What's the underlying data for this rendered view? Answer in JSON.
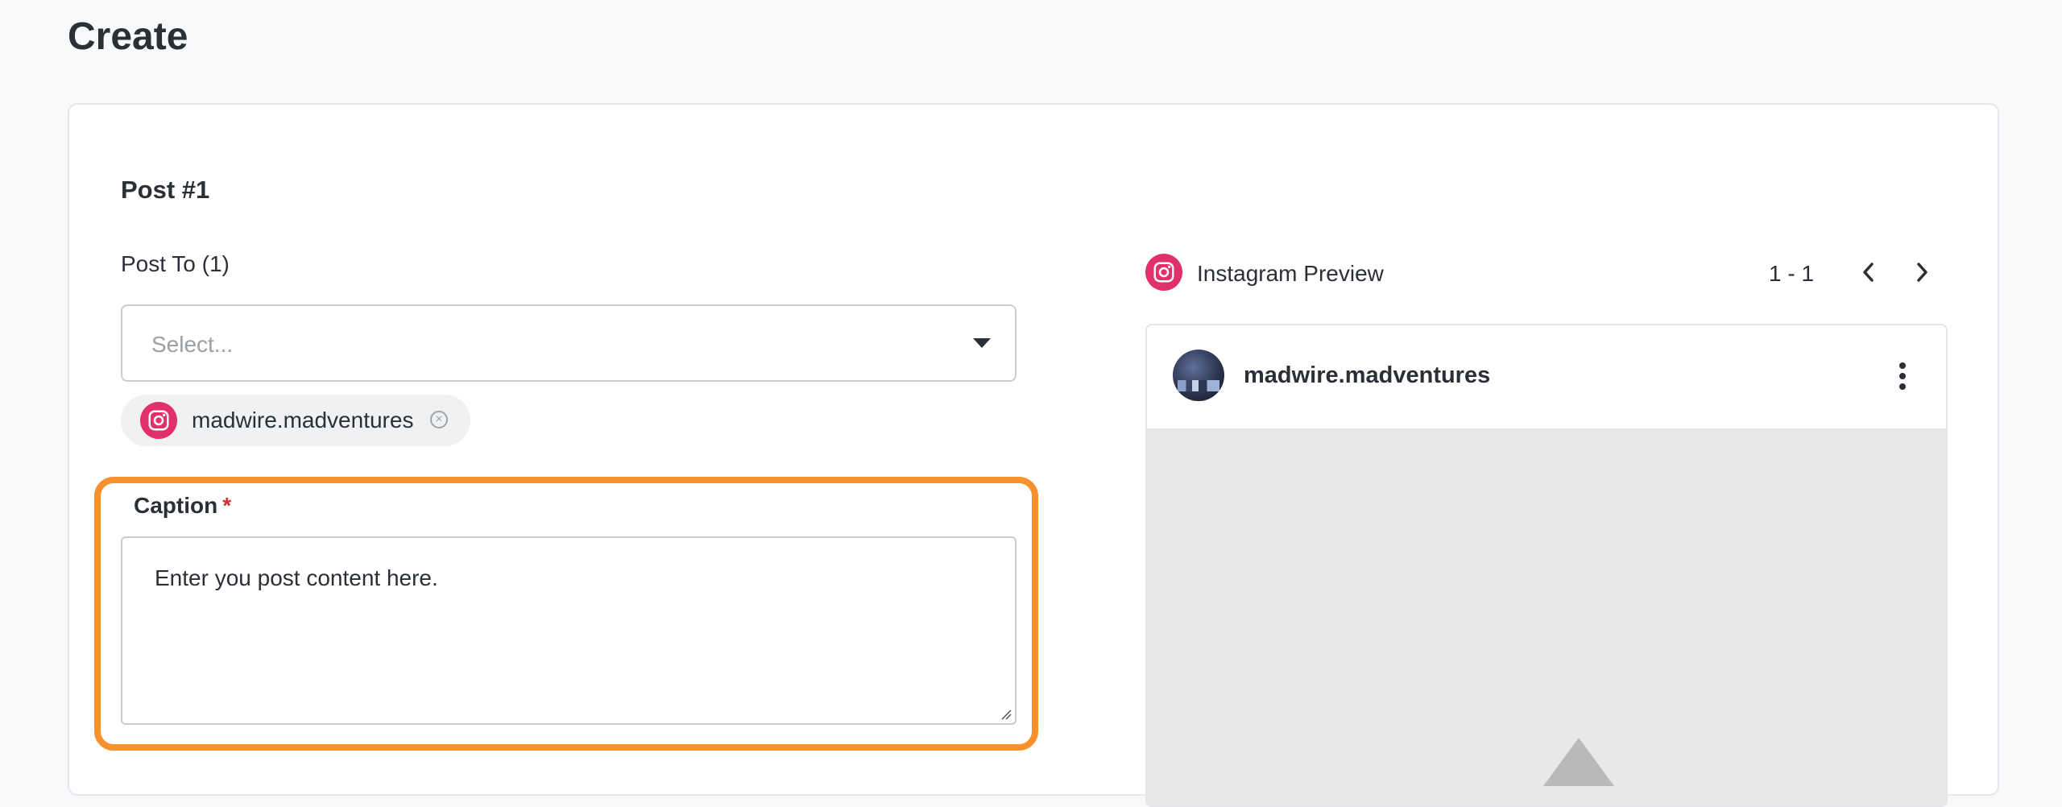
{
  "page": {
    "title": "Create"
  },
  "post": {
    "title": "Post #1",
    "post_to_label": "Post To (1)",
    "select": {
      "placeholder": "Select..."
    },
    "chips": [
      {
        "platform": "instagram-icon",
        "label": "madwire.madventures"
      }
    ],
    "caption": {
      "label": "Caption",
      "required_marker": "*",
      "value": "Enter you post content here."
    }
  },
  "preview": {
    "title": "Instagram Preview",
    "pager": "1 - 1",
    "username": "madwire.madventures"
  },
  "colors": {
    "highlight": "#f7912e",
    "instagram": "#e1306c",
    "required": "#d32f2f"
  }
}
